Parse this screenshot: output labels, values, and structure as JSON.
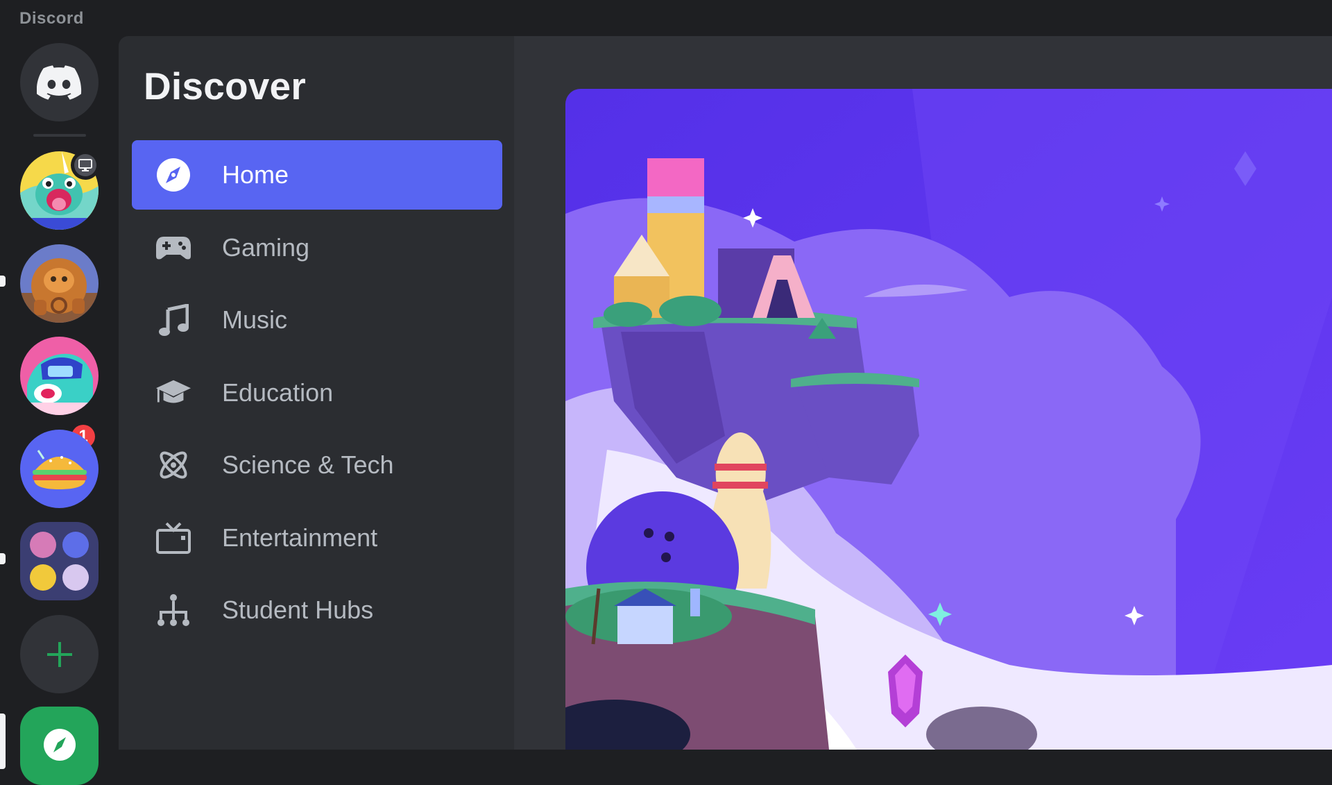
{
  "window": {
    "title": "Discord"
  },
  "rail": {
    "unread_badge": "1",
    "servers": [
      "server-1",
      "server-2",
      "server-3",
      "server-4",
      "server-folder"
    ]
  },
  "sidebar": {
    "title": "Discover",
    "items": [
      {
        "label": "Home",
        "icon": "compass-icon",
        "active": true
      },
      {
        "label": "Gaming",
        "icon": "gamepad-icon"
      },
      {
        "label": "Music",
        "icon": "music-note-icon"
      },
      {
        "label": "Education",
        "icon": "graduation-cap-icon"
      },
      {
        "label": "Science & Tech",
        "icon": "atom-icon"
      },
      {
        "label": "Entertainment",
        "icon": "tv-icon"
      },
      {
        "label": "Student Hubs",
        "icon": "hub-tree-icon"
      }
    ]
  },
  "colors": {
    "accent": "#5865f2",
    "green": "#23a55a",
    "red": "#f23f43",
    "rail_bg": "#1e1f22",
    "sidebar_bg": "#2b2d31",
    "main_bg": "#313338"
  }
}
